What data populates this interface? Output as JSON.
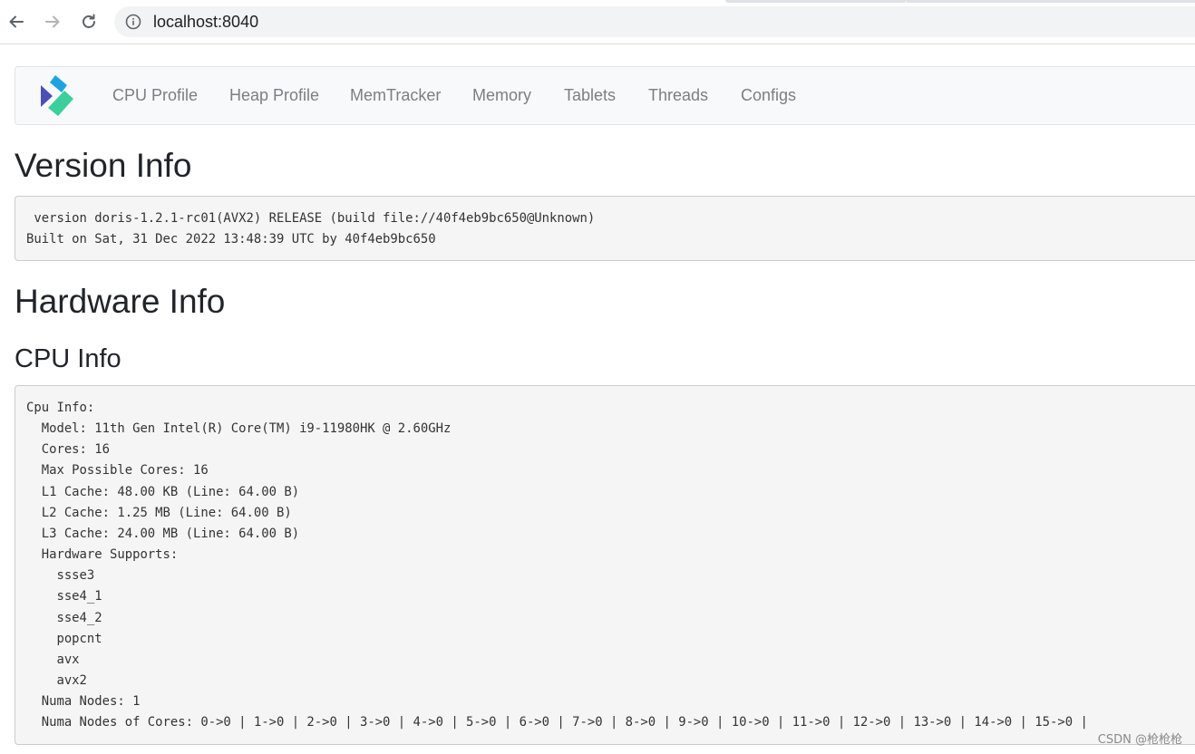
{
  "browser": {
    "url": "localhost:8040"
  },
  "navbar": {
    "links": [
      "CPU Profile",
      "Heap Profile",
      "MemTracker",
      "Memory",
      "Tablets",
      "Threads",
      "Configs"
    ]
  },
  "version_section": {
    "title": "Version Info",
    "text": " version doris-1.2.1-rc01(AVX2) RELEASE (build file://40f4eb9bc650@Unknown)\nBuilt on Sat, 31 Dec 2022 13:48:39 UTC by 40f4eb9bc650"
  },
  "hardware_section": {
    "title": "Hardware Info"
  },
  "cpu_section": {
    "title": "CPU Info",
    "text": "Cpu Info:\n  Model: 11th Gen Intel(R) Core(TM) i9-11980HK @ 2.60GHz\n  Cores: 16\n  Max Possible Cores: 16\n  L1 Cache: 48.00 KB (Line: 64.00 B)\n  L2 Cache: 1.25 MB (Line: 64.00 B)\n  L3 Cache: 24.00 MB (Line: 64.00 B)\n  Hardware Supports:\n    ssse3\n    sse4_1\n    sse4_2\n    popcnt\n    avx\n    avx2\n  Numa Nodes: 1\n  Numa Nodes of Cores: 0->0 | 1->0 | 2->0 | 3->0 | 4->0 | 5->0 | 6->0 | 7->0 | 8->0 | 9->0 | 10->0 | 11->0 | 12->0 | 13->0 | 14->0 | 15->0 |"
  },
  "watermark": "CSDN @枪枪枪",
  "colors": {
    "logo_blue": "#1fa3e0",
    "logo_indigo": "#4b50b8",
    "logo_green": "#3ccf9c"
  }
}
